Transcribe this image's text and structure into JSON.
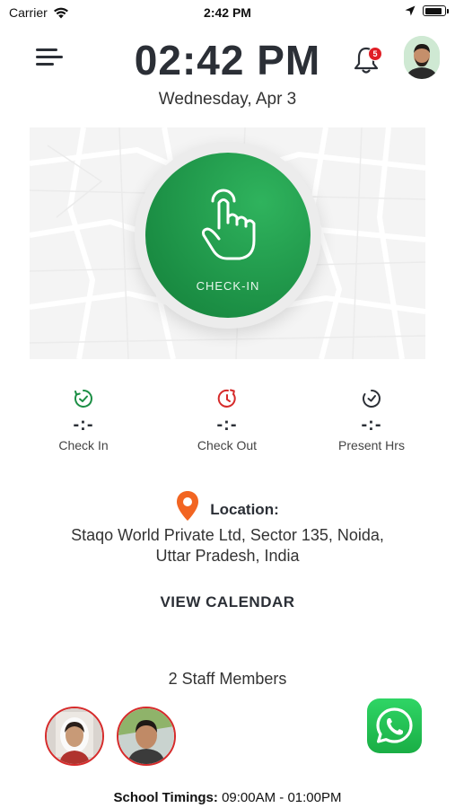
{
  "status_bar": {
    "carrier": "Carrier",
    "time": "2:42 PM",
    "battery_level": 0.9
  },
  "header": {
    "clock": "02:42 PM",
    "date": "Wednesday, Apr 3",
    "notification_count": "5",
    "icons": {
      "menu": "menu-icon",
      "bell": "bell-icon"
    }
  },
  "checkin": {
    "label": "CHECK-IN",
    "icon": "hand-pointer-icon",
    "color": "#1f9a4c"
  },
  "stats": [
    {
      "label": "Check In",
      "value": "-:-",
      "icon": "clock-check-icon",
      "color": "#1b8e44"
    },
    {
      "label": "Check Out",
      "value": "-:-",
      "icon": "clock-out-icon",
      "color": "#d62b2b"
    },
    {
      "label": "Present Hrs",
      "value": "-:-",
      "icon": "clock-icon",
      "color": "#2b2f36"
    }
  ],
  "location": {
    "title": "Location:",
    "address_line1": "Staqo World Private Ltd, Sector 135, Noida,",
    "address_line2": "Uttar Pradesh, India",
    "pin_color": "#f26522"
  },
  "view_calendar": "VIEW CALENDAR",
  "staff": {
    "title": "2 Staff Members"
  },
  "whatsapp": {
    "icon": "whatsapp-icon",
    "color": "#25d366"
  },
  "school_timings": {
    "label": "School Timings:",
    "value": "09:00AM - 01:00PM"
  }
}
